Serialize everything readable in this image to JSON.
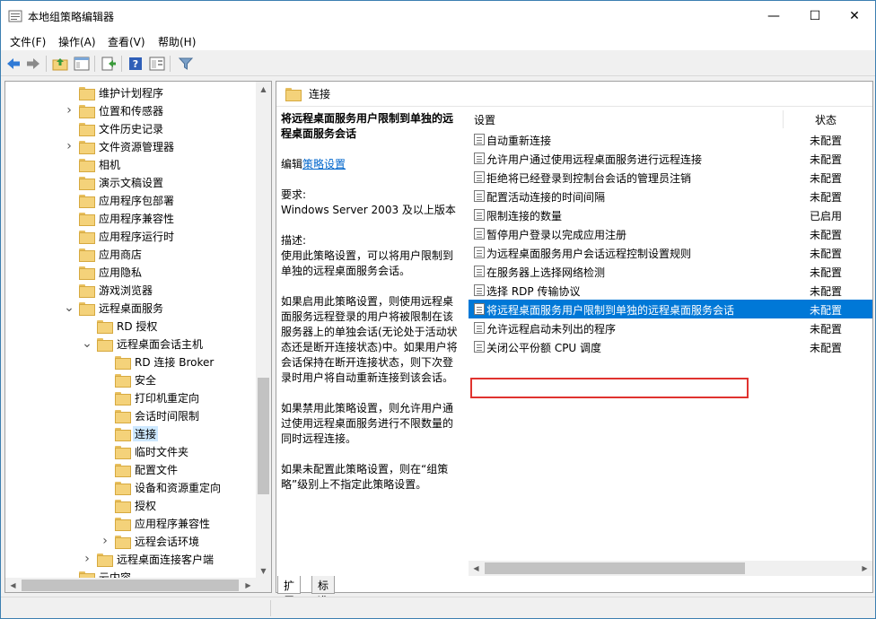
{
  "window": {
    "title": "本地组策略编辑器",
    "minimize_glyph": "—",
    "maximize_glyph": "☐",
    "close_glyph": "✕"
  },
  "menu": [
    "文件(F)",
    "操作(A)",
    "查看(V)",
    "帮助(H)"
  ],
  "toolbar": {
    "icons": [
      "back-arrow-icon",
      "forward-arrow-icon",
      "up-folder-icon",
      "show-hide-tree-icon",
      "export-list-icon",
      "help-icon",
      "properties-icon",
      "filter-icon"
    ]
  },
  "tree": {
    "items": [
      {
        "label": "维护计划程序",
        "indent": 1,
        "twisty": ""
      },
      {
        "label": "位置和传感器",
        "indent": 1,
        "twisty": ">"
      },
      {
        "label": "文件历史记录",
        "indent": 1,
        "twisty": ""
      },
      {
        "label": "文件资源管理器",
        "indent": 1,
        "twisty": ">"
      },
      {
        "label": "相机",
        "indent": 1,
        "twisty": ""
      },
      {
        "label": "演示文稿设置",
        "indent": 1,
        "twisty": ""
      },
      {
        "label": "应用程序包部署",
        "indent": 1,
        "twisty": ""
      },
      {
        "label": "应用程序兼容性",
        "indent": 1,
        "twisty": ""
      },
      {
        "label": "应用程序运行时",
        "indent": 1,
        "twisty": ""
      },
      {
        "label": "应用商店",
        "indent": 1,
        "twisty": ""
      },
      {
        "label": "应用隐私",
        "indent": 1,
        "twisty": ""
      },
      {
        "label": "游戏浏览器",
        "indent": 1,
        "twisty": ""
      },
      {
        "label": "远程桌面服务",
        "indent": 1,
        "twisty": "v"
      },
      {
        "label": "RD 授权",
        "indent": 2,
        "twisty": ""
      },
      {
        "label": "远程桌面会话主机",
        "indent": 2,
        "twisty": "v"
      },
      {
        "label": "RD 连接 Broker",
        "indent": 3,
        "twisty": ""
      },
      {
        "label": "安全",
        "indent": 3,
        "twisty": ""
      },
      {
        "label": "打印机重定向",
        "indent": 3,
        "twisty": ""
      },
      {
        "label": "会话时间限制",
        "indent": 3,
        "twisty": ""
      },
      {
        "label": "连接",
        "indent": 3,
        "twisty": "",
        "selected": true
      },
      {
        "label": "临时文件夹",
        "indent": 3,
        "twisty": ""
      },
      {
        "label": "配置文件",
        "indent": 3,
        "twisty": ""
      },
      {
        "label": "设备和资源重定向",
        "indent": 3,
        "twisty": ""
      },
      {
        "label": "授权",
        "indent": 3,
        "twisty": ""
      },
      {
        "label": "应用程序兼容性",
        "indent": 3,
        "twisty": ""
      },
      {
        "label": "远程会话环境",
        "indent": 3,
        "twisty": ">"
      },
      {
        "label": "远程桌面连接客户端",
        "indent": 2,
        "twisty": ">"
      },
      {
        "label": "云内容",
        "indent": 1,
        "twisty": ""
      }
    ]
  },
  "right": {
    "header": "连接",
    "description": {
      "heading": "将远程桌面服务用户限制到单独的远程桌面服务会话",
      "edit_prefix": "编辑",
      "edit_link": "策略设置",
      "requirements_label": "要求:",
      "requirements": "Windows Server 2003 及以上版本",
      "desc_label": "描述:",
      "desc_1": "使用此策略设置，可以将用户限制到单独的远程桌面服务会话。",
      "desc_2": "如果启用此策略设置，则使用远程桌面服务远程登录的用户将被限制在该服务器上的单独会话(无论处于活动状态还是断开连接状态)中。如果用户将会话保持在断开连接状态，则下次登录时用户将自动重新连接到该会话。",
      "desc_3": "如果禁用此策略设置，则允许用户通过使用远程桌面服务进行不限数量的同时远程连接。",
      "desc_4": "如果未配置此策略设置，则在“组策略”级别上不指定此策略设置。"
    },
    "columns": {
      "setting": "设置",
      "state": "状态"
    },
    "policies": [
      {
        "name": "自动重新连接",
        "state": "未配置"
      },
      {
        "name": "允许用户通过使用远程桌面服务进行远程连接",
        "state": "未配置"
      },
      {
        "name": "拒绝将已经登录到控制台会话的管理员注销",
        "state": "未配置"
      },
      {
        "name": "配置活动连接的时间间隔",
        "state": "未配置"
      },
      {
        "name": "限制连接的数量",
        "state": "已启用"
      },
      {
        "name": "暂停用户登录以完成应用注册",
        "state": "未配置"
      },
      {
        "name": "为远程桌面服务用户会话远程控制设置规则",
        "state": "未配置"
      },
      {
        "name": "在服务器上选择网络检测",
        "state": "未配置"
      },
      {
        "name": "选择 RDP 传输协议",
        "state": "未配置"
      },
      {
        "name": "将远程桌面服务用户限制到单独的远程桌面服务会话",
        "state": "未配置",
        "selected": true
      },
      {
        "name": "允许远程启动未列出的程序",
        "state": "未配置"
      },
      {
        "name": "关闭公平份额 CPU 调度",
        "state": "未配置"
      }
    ]
  },
  "tabs": [
    "扩展",
    "标准"
  ],
  "scroll_arrows": {
    "up": "▲",
    "down": "▼",
    "left": "◀",
    "right": "▶"
  }
}
